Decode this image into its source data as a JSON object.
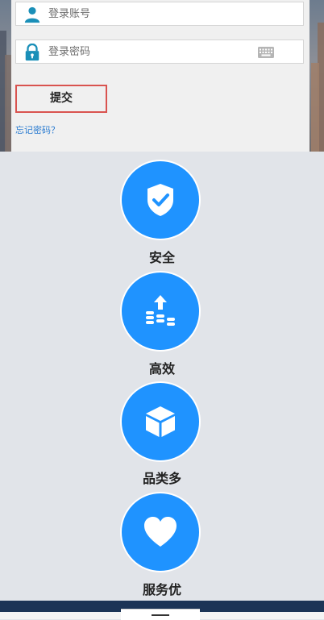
{
  "login": {
    "account_placeholder": "登录账号",
    "password_placeholder": "登录密码",
    "submit_label": "提交",
    "forgot_label": "忘记密码？"
  },
  "features": [
    {
      "label": "安全",
      "icon": "shield-check-icon"
    },
    {
      "label": "高效",
      "icon": "coins-arrow-up-icon"
    },
    {
      "label": "品类多",
      "icon": "box-icon"
    },
    {
      "label": "服务优",
      "icon": "heart-icon"
    }
  ],
  "colors": {
    "accent": "#1f93ff",
    "icon_teal": "#1a8fb8",
    "submit_border": "#d9534f",
    "link": "#2a7bd0",
    "footer": "#1c3456",
    "background": "#e1e4e9"
  }
}
